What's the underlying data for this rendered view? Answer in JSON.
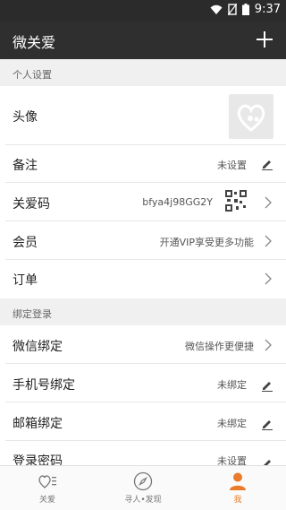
{
  "status_bar": {
    "time": "9:37"
  },
  "app_bar": {
    "title": "微关爱",
    "add_icon": "plus-icon"
  },
  "sections": {
    "personal": "个人设置",
    "binding": "绑定登录"
  },
  "personal": {
    "avatar": {
      "label": "头像"
    },
    "remark": {
      "label": "备注",
      "value": "未设置"
    },
    "care_code": {
      "label": "关爱码",
      "value": "bfya4j98GG2Y"
    },
    "member": {
      "label": "会员",
      "value": "开通VIP享受更多功能"
    },
    "order": {
      "label": "订单"
    }
  },
  "binding": {
    "wechat": {
      "label": "微信绑定",
      "value": "微信操作更便捷"
    },
    "phone": {
      "label": "手机号绑定",
      "value": "未绑定"
    },
    "email": {
      "label": "邮箱绑定",
      "value": "未绑定"
    },
    "password": {
      "label": "登录密码",
      "value": "未设置"
    }
  },
  "tabbar": {
    "tabs": [
      {
        "label": "关爱",
        "icon": "heart-list-icon",
        "active": false
      },
      {
        "label": "寻人•发现",
        "icon": "compass-icon",
        "active": false
      },
      {
        "label": "我",
        "icon": "person-icon",
        "active": true
      }
    ]
  },
  "colors": {
    "accent": "#e97b2b",
    "header": "#2f2f2f",
    "section_bg": "#f0f0f0"
  }
}
